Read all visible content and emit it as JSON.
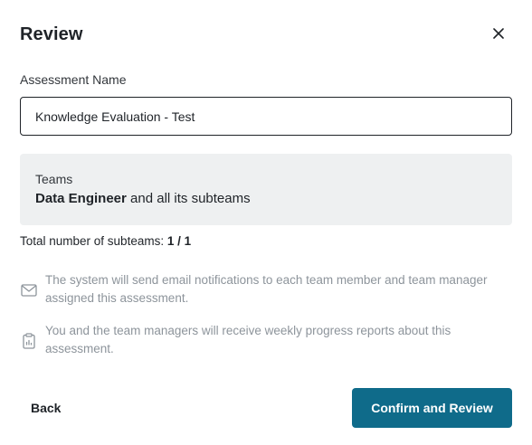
{
  "dialog": {
    "title": "Review",
    "close_icon": "close-icon"
  },
  "assessment": {
    "label": "Assessment Name",
    "value": "Knowledge Evaluation - Test"
  },
  "teams": {
    "label": "Teams",
    "team_name": "Data Engineer",
    "team_suffix": " and all its subteams"
  },
  "subteams": {
    "label": "Total number of subteams: ",
    "count": "1 / 1"
  },
  "notices": {
    "email": {
      "icon": "envelope-icon",
      "text": "The system will send email notifications to each team member and team manager assigned this assessment."
    },
    "reports": {
      "icon": "clipboard-icon",
      "text": "You and the team managers will receive weekly progress reports about this assessment."
    }
  },
  "actions": {
    "back_label": "Back",
    "confirm_label": "Confirm and Review"
  },
  "colors": {
    "primary": "#0f6b8a",
    "panel_bg": "#eef0f1",
    "muted_text": "#8d949b"
  }
}
